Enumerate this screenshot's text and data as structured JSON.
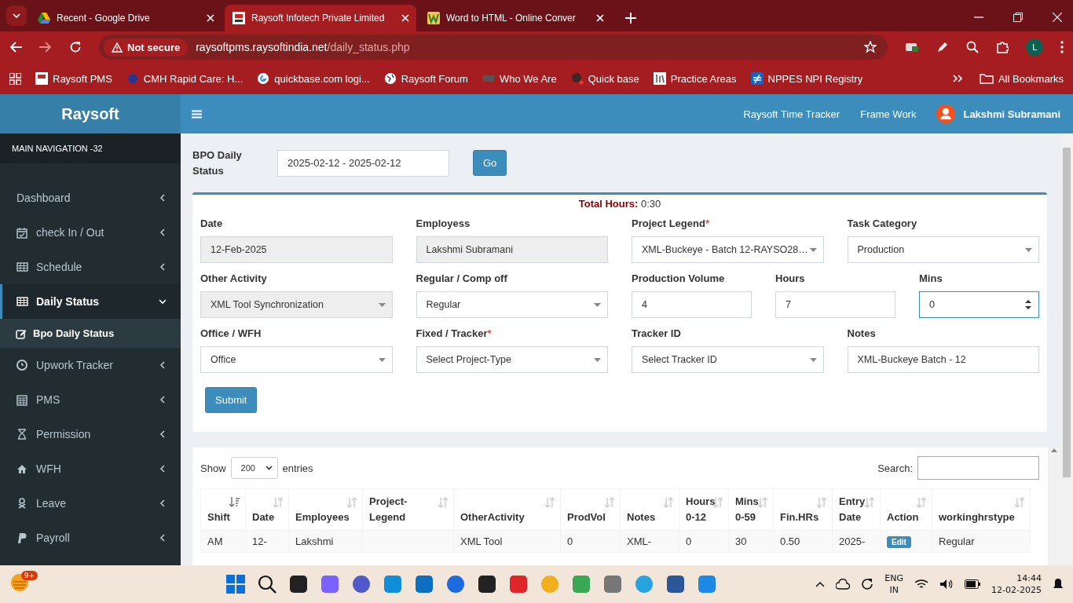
{
  "browser": {
    "tabs": [
      {
        "title": "Recent - Google Drive",
        "selected": false
      },
      {
        "title": "Raysoft Infotech Private Limited",
        "selected": true
      },
      {
        "title": "Word to HTML - Online Conver",
        "selected": false
      }
    ],
    "address": {
      "security": "Not secure",
      "host": "raysoftpms.raysoftindia.net",
      "path": "/daily_status.php"
    },
    "profile_initial": "L",
    "bookmarks": [
      "Raysoft PMS",
      "CMH Rapid Care: H...",
      "quickbase.com logi...",
      "Raysoft Forum",
      "Who We Are",
      "Quick base",
      "Practice Areas",
      "NPPES NPI Registry"
    ],
    "all_bookmarks": "All Bookmarks"
  },
  "app": {
    "brand": "Raysoft",
    "nav_header": "MAIN NAVIGATION -32",
    "nav": [
      {
        "label": "Dashboard",
        "selected": false,
        "expanded": false
      },
      {
        "label": "check In / Out",
        "selected": false,
        "expanded": false
      },
      {
        "label": "Schedule",
        "selected": false,
        "expanded": false
      },
      {
        "label": "Daily Status",
        "selected": true,
        "expanded": true,
        "children": [
          {
            "label": "Bpo Daily Status",
            "selected": true
          }
        ]
      },
      {
        "label": "Upwork Tracker",
        "selected": false,
        "expanded": false
      },
      {
        "label": "PMS",
        "selected": false,
        "expanded": false
      },
      {
        "label": "Permission",
        "selected": false,
        "expanded": false
      },
      {
        "label": "WFH",
        "selected": false,
        "expanded": false
      },
      {
        "label": "Leave",
        "selected": false,
        "expanded": false
      },
      {
        "label": "Payroll",
        "selected": false,
        "expanded": false
      }
    ],
    "top_links": [
      "Raysoft Time Tracker",
      "Frame Work"
    ],
    "user": "Lakshmi Subramani",
    "filter": {
      "label": "BPO Daily Status",
      "date_range": "2025-02-12 - 2025-02-12",
      "button": "Go"
    },
    "total_hours": {
      "label": "Total Hours:",
      "value": "0:30"
    },
    "form_rows": [
      [
        {
          "label": "Date",
          "kind": "text",
          "value": "12-Feb-2025",
          "disabled": true
        },
        {
          "label": "Employess",
          "kind": "text",
          "value": "Lakshmi Subramani",
          "disabled": true
        },
        {
          "label": "Project Legend",
          "required_mark": "*",
          "kind": "select",
          "value": "XML-Buckeye - Batch 12-RAYSO28…",
          "disabled": false
        },
        {
          "label": "Task Category",
          "kind": "select",
          "value": "Production",
          "disabled": false
        }
      ],
      [
        {
          "label": "Other Activity",
          "kind": "select",
          "value": "XML Tool Synchronization",
          "disabled": true
        },
        {
          "label": "Regular / Comp off",
          "kind": "select",
          "value": "Regular",
          "disabled": false
        },
        {
          "label": "Production Volume",
          "kind": "text",
          "value": "4",
          "disabled": false
        },
        {
          "label": "Hours",
          "kind": "text",
          "value": "7",
          "disabled": false
        },
        {
          "label": "Mins",
          "kind": "number",
          "value": "0",
          "disabled": false,
          "focused": true
        }
      ],
      [
        {
          "label": "Office / WFH",
          "kind": "select",
          "value": "Office",
          "disabled": false
        },
        {
          "label": "Fixed / Tracker",
          "required_mark": "*",
          "kind": "select",
          "value": "Select Project-Type",
          "disabled": false
        },
        {
          "label": "Tracker ID",
          "kind": "select",
          "value": "Select Tracker ID",
          "disabled": false
        },
        {
          "label": "Notes",
          "kind": "text",
          "value": "XML-Buckeye Batch - 12",
          "disabled": false
        }
      ]
    ],
    "submit": "Submit",
    "table": {
      "show": "Show",
      "length": "200",
      "entries": "entries",
      "search_label": "Search:",
      "columns": [
        {
          "label": "Shift",
          "sorted": true
        },
        {
          "label": "Date",
          "sorted": false
        },
        {
          "label": "Employees",
          "sorted": false
        },
        {
          "label": "Project-Legend",
          "sorted": false
        },
        {
          "label": "OtherActivity",
          "sorted": false
        },
        {
          "label": "ProdVol",
          "sorted": false
        },
        {
          "label": "Notes",
          "sorted": false
        },
        {
          "label": "Hours 0-12",
          "sorted": false
        },
        {
          "label": "Mins 0-59",
          "sorted": false
        },
        {
          "label": "Fin.HRs",
          "sorted": false
        },
        {
          "label": "Entry Date",
          "sorted": false
        },
        {
          "label": "Action",
          "sorted": false
        },
        {
          "label": "workinghrstype",
          "sorted": false
        }
      ],
      "rows": [
        {
          "cells": [
            "AM",
            "12-",
            "Lakshmi",
            "",
            "XML Tool",
            "0",
            "XML-",
            "0",
            "30",
            "0.50",
            "2025-",
            "",
            "Regular"
          ],
          "action": "Edit"
        }
      ]
    }
  },
  "taskbar": {
    "badge": "9+",
    "lang": "ENG",
    "region": "IN",
    "time": "14:44",
    "date": "12-02-2025"
  }
}
